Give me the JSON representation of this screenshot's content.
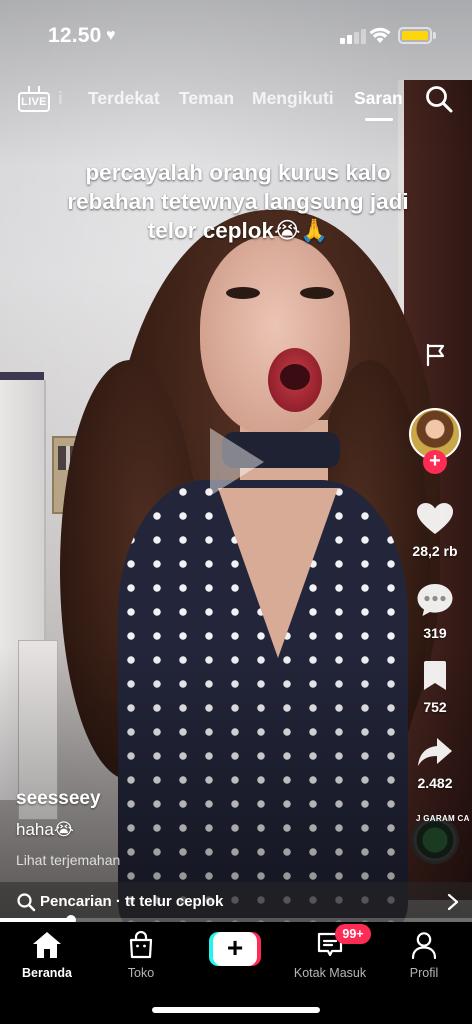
{
  "status_bar": {
    "time": "12.50"
  },
  "top_tabs": {
    "live_label": "LIVE",
    "ghost_label": "i",
    "tabs": [
      {
        "label": "Terdekat",
        "active": false
      },
      {
        "label": "Teman",
        "active": false
      },
      {
        "label": "Mengikuti",
        "active": false
      },
      {
        "label": "Saran",
        "active": true
      }
    ]
  },
  "video": {
    "overlay_caption": "percayalah orang kurus kalo rebahan tetewnya langsung jadi telor ceplok😭🙏"
  },
  "rail": {
    "follow_symbol": "+",
    "likes": "28,2 rb",
    "comments": "319",
    "bookmarks": "752",
    "shares": "2.482",
    "music_label": "J GARAM CA"
  },
  "creator": {
    "username": "seesseey",
    "description": "haha😭",
    "translate_link": "Lihat terjemahan"
  },
  "search_suggestion": {
    "text": "Pencarian · tt telur ceplok"
  },
  "playback": {
    "progress": 0.15
  },
  "bottom_nav": {
    "items": [
      {
        "label": "Beranda",
        "active": true
      },
      {
        "label": "Toko",
        "active": false
      },
      {
        "label": "",
        "active": false
      },
      {
        "label": "Kotak Masuk",
        "active": false
      },
      {
        "label": "Profil",
        "active": false
      }
    ],
    "create_symbol": "+",
    "inbox_badge": "99+"
  },
  "colors": {
    "accent": "#fe2c55",
    "accent_cyan": "#25f4ee",
    "battery": "#ffd60a"
  }
}
